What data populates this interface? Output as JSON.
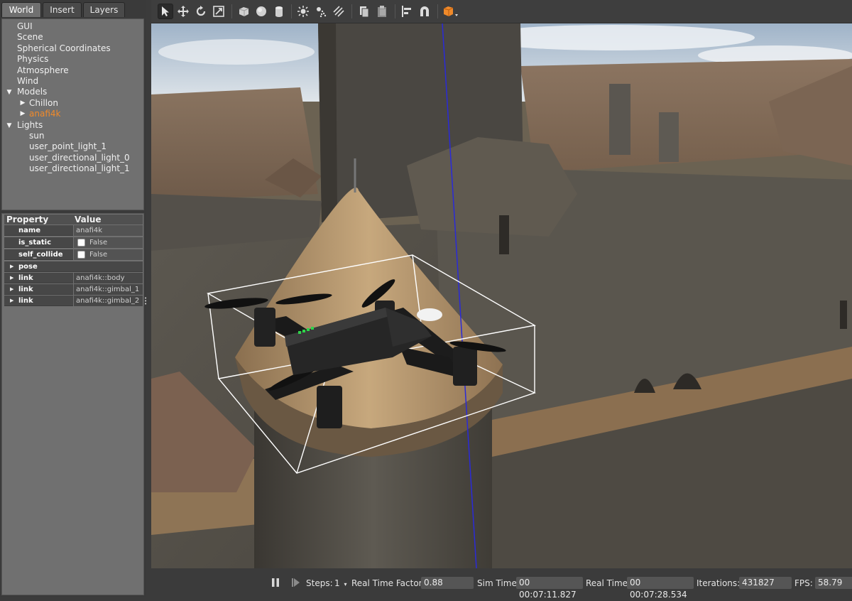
{
  "tabs": [
    {
      "label": "World"
    },
    {
      "label": "Insert"
    },
    {
      "label": "Layers"
    }
  ],
  "world_tree": {
    "gui": "GUI",
    "scene": "Scene",
    "spherical": "Spherical Coordinates",
    "physics": "Physics",
    "atmosphere": "Atmosphere",
    "wind": "Wind",
    "models": "Models",
    "model_items": [
      "Chillon",
      "anafi4k"
    ],
    "lights": "Lights",
    "light_items": [
      "sun",
      "user_point_light_1",
      "user_directional_light_0",
      "user_directional_light_1"
    ]
  },
  "properties": {
    "header_property": "Property",
    "header_value": "Value",
    "name_key": "name",
    "name_val": "anafi4k",
    "is_static_key": "is_static",
    "is_static_val": "False",
    "self_collide_key": "self_collide",
    "self_collide_val": "False",
    "pose_key": "pose",
    "links": [
      {
        "key": "link",
        "val": "anafi4k::body"
      },
      {
        "key": "link",
        "val": "anafi4k::gimbal_1"
      },
      {
        "key": "link",
        "val": "anafi4k::gimbal_2"
      }
    ]
  },
  "toolbar": {
    "icons": [
      "select-icon",
      "translate-icon",
      "rotate-icon",
      "scale-icon",
      "box-icon",
      "sphere-icon",
      "cylinder-icon",
      "point-light-icon",
      "spot-light-icon",
      "directional-light-icon",
      "copy-icon",
      "paste-icon",
      "align-icon",
      "snap-icon",
      "view-angle-icon"
    ]
  },
  "statusbar": {
    "steps_label": "Steps:",
    "steps_value": "1",
    "rtf_label": "Real Time Factor:",
    "rtf_value": "0.88",
    "sim_time_label": "Sim Time:",
    "sim_time_value": "00 00:07:11.827",
    "real_time_label": "Real Time:",
    "real_time_value": "00 00:07:28.534",
    "iterations_label": "Iterations:",
    "iterations_value": "431827",
    "fps_label": "FPS:",
    "fps_value": "58.79"
  },
  "colors": {
    "selected_item": "#f08a2a",
    "panel_bg": "#707070",
    "bounding_box": "#ffffff",
    "z_axis": "#2a2ad8"
  }
}
